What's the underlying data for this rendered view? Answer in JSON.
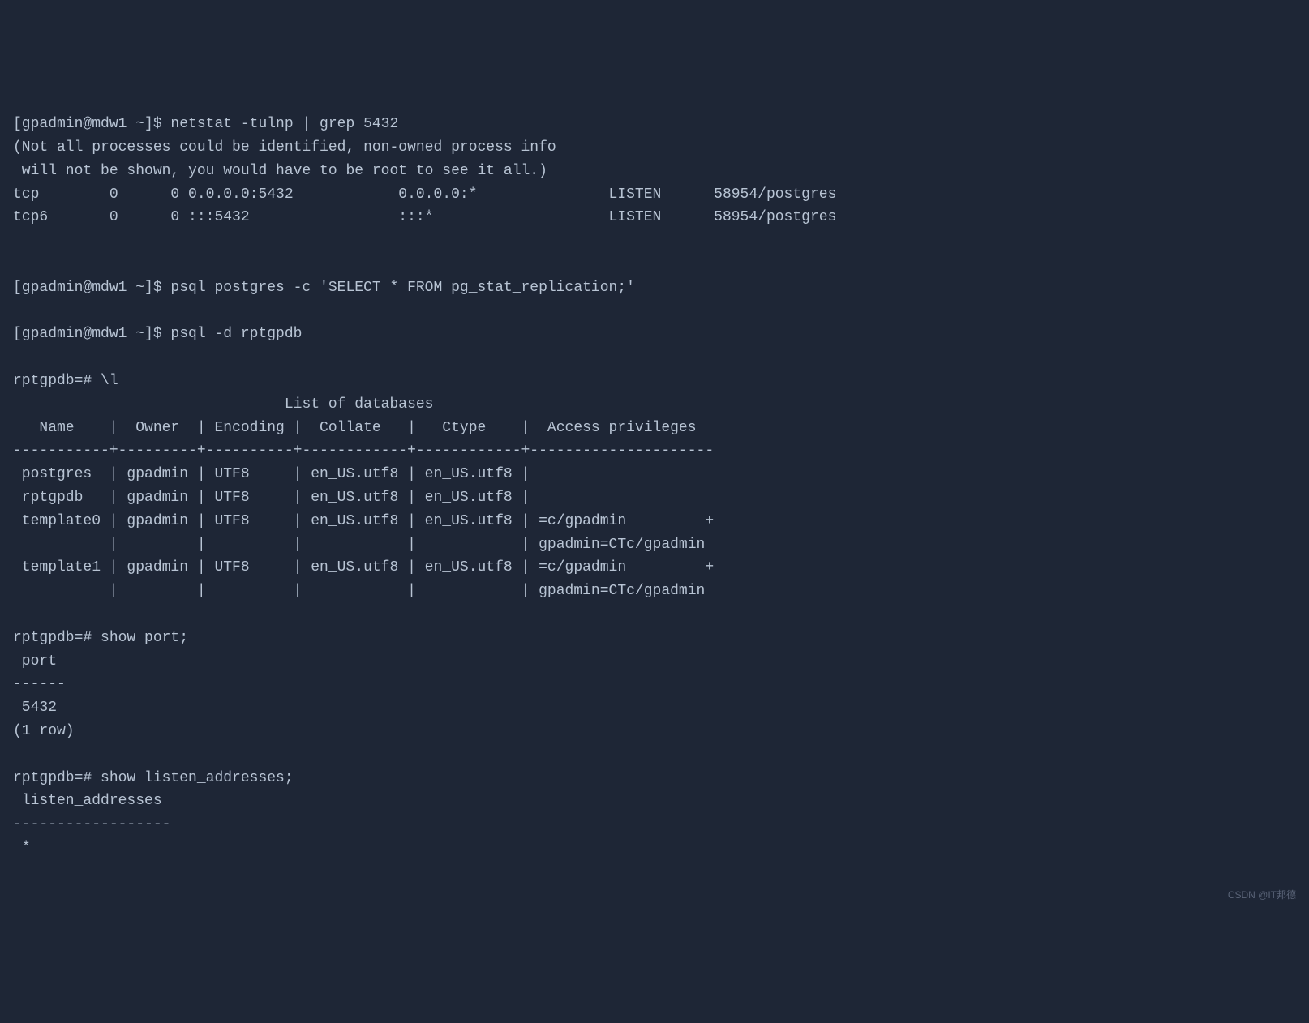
{
  "lines": {
    "l1": "[gpadmin@mdw1 ~]$ netstat -tulnp | grep 5432",
    "l2": "(Not all processes could be identified, non-owned process info",
    "l3": " will not be shown, you would have to be root to see it all.)",
    "l4": "tcp        0      0 0.0.0.0:5432            0.0.0.0:*               LISTEN      58954/postgres",
    "l5": "tcp6       0      0 :::5432                 :::*                    LISTEN      58954/postgres",
    "l6": "",
    "l7": "",
    "l8": "[gpadmin@mdw1 ~]$ psql postgres -c 'SELECT * FROM pg_stat_replication;'",
    "l9": "",
    "l10": "[gpadmin@mdw1 ~]$ psql -d rptgpdb",
    "l11": "",
    "l12": "rptgpdb=# \\l",
    "l13": "                               List of databases",
    "l14": "   Name    |  Owner  | Encoding |  Collate   |   Ctype    |  Access privileges  ",
    "l15": "-----------+---------+----------+------------+------------+---------------------",
    "l16": " postgres  | gpadmin | UTF8     | en_US.utf8 | en_US.utf8 | ",
    "l17": " rptgpdb   | gpadmin | UTF8     | en_US.utf8 | en_US.utf8 | ",
    "l18": " template0 | gpadmin | UTF8     | en_US.utf8 | en_US.utf8 | =c/gpadmin         +",
    "l19": "           |         |          |            |            | gpadmin=CTc/gpadmin",
    "l20": " template1 | gpadmin | UTF8     | en_US.utf8 | en_US.utf8 | =c/gpadmin         +",
    "l21": "           |         |          |            |            | gpadmin=CTc/gpadmin",
    "l22": "",
    "l23": "rptgpdb=# show port;",
    "l24": " port ",
    "l25": "------",
    "l26": " 5432",
    "l27": "(1 row)",
    "l28": "",
    "l29": "rptgpdb=# show listen_addresses;",
    "l30": " listen_addresses ",
    "l31": "------------------",
    "l32": " *"
  },
  "watermark": "CSDN @IT邦德"
}
